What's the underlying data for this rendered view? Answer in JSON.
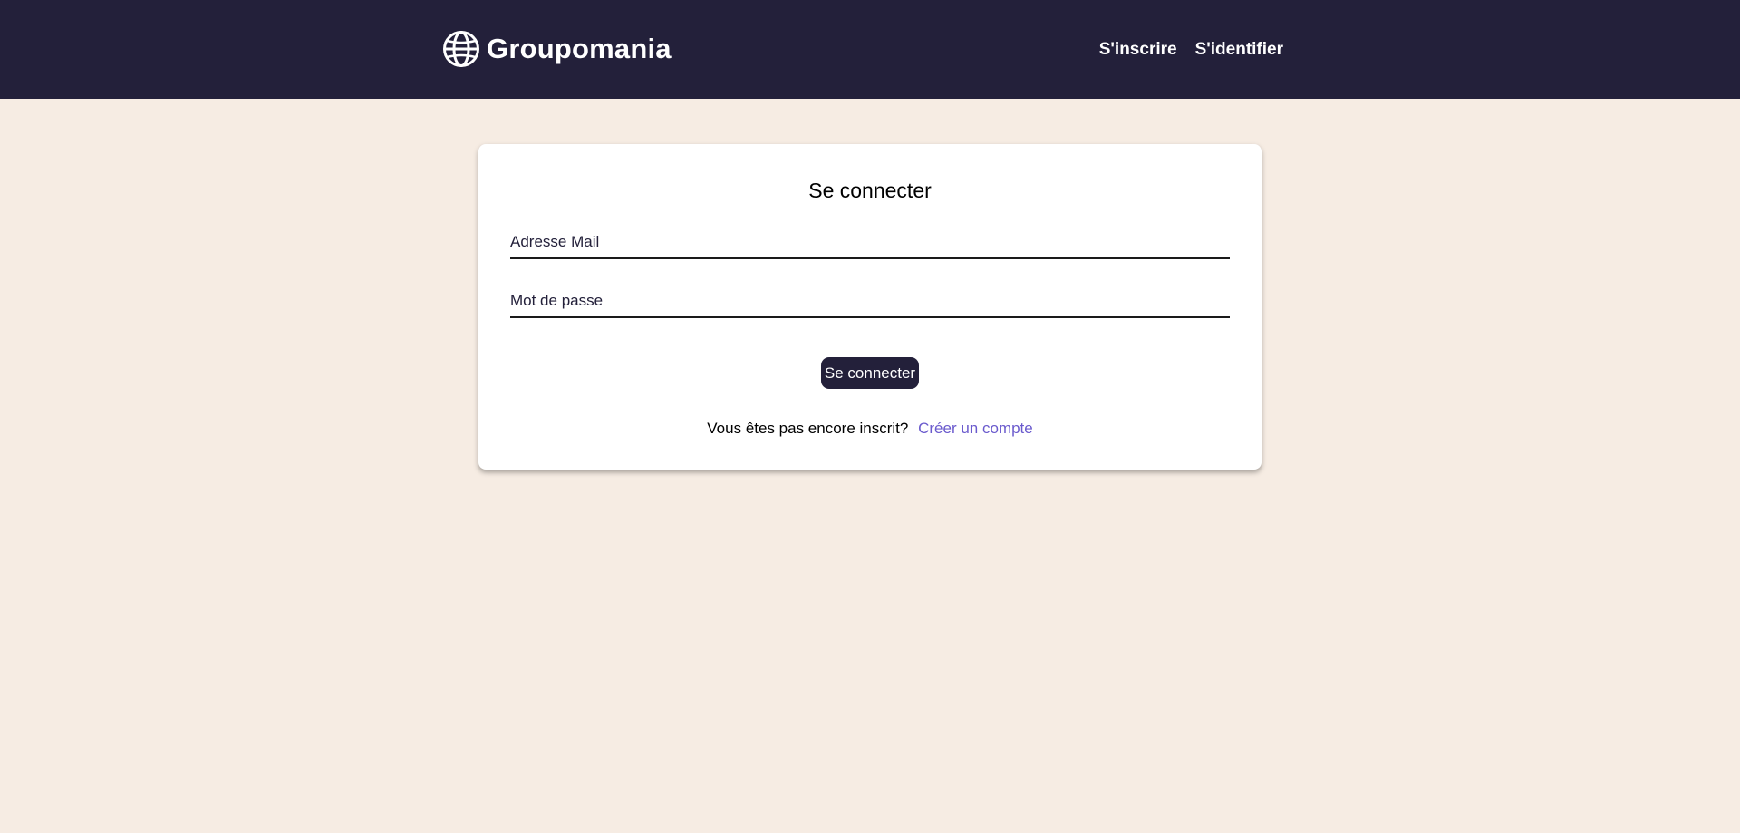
{
  "header": {
    "logo_text": "Groupomania",
    "nav": {
      "signup_label": "S'inscrire",
      "login_label": "S'identifier"
    }
  },
  "login_form": {
    "title": "Se connecter",
    "email_placeholder": "Adresse Mail",
    "password_placeholder": "Mot de passe",
    "submit_label": "Se connecter",
    "signup_prompt": "Vous êtes pas encore inscrit?",
    "signup_link": "Créer un compte"
  },
  "colors": {
    "header_bg": "#23203a",
    "page_bg": "#f6ece3",
    "card_bg": "#ffffff",
    "link": "#6a5acd"
  },
  "icons": {
    "logo": "globe-icon"
  }
}
